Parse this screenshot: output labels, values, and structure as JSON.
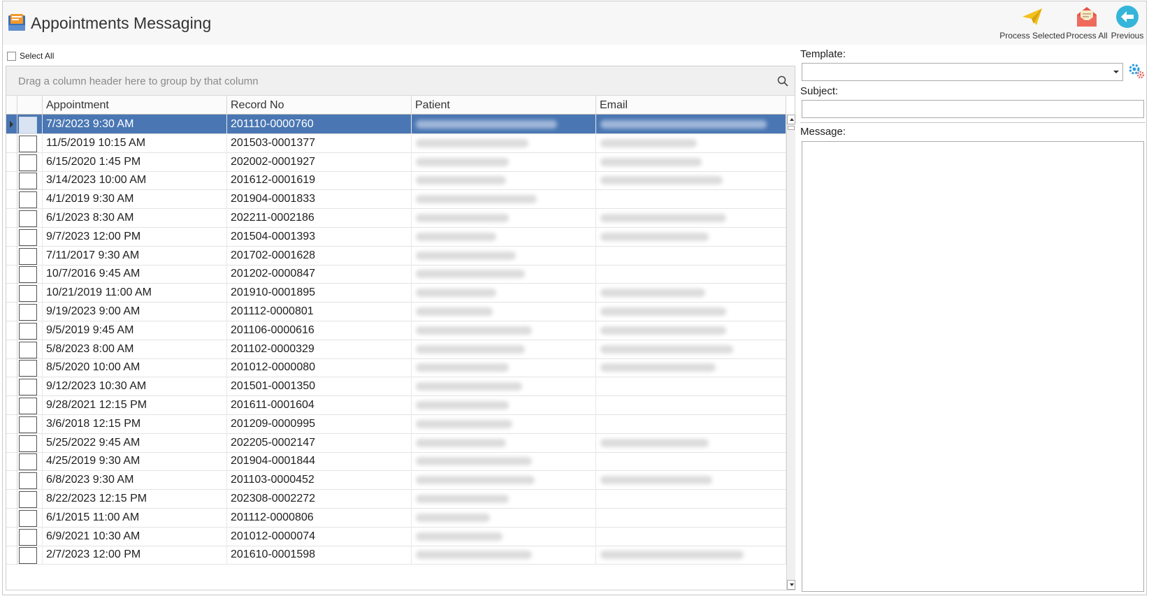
{
  "app": {
    "title": "Appointments Messaging"
  },
  "toolbar": {
    "process_selected": "Process Selected",
    "process_all": "Process All",
    "previous": "Previous"
  },
  "select_all": {
    "label": "Select All",
    "checked": false
  },
  "grid": {
    "group_hint": "Drag a column header here to group by that column",
    "columns": [
      "Appointment",
      "Record No",
      "Patient",
      "Email"
    ],
    "selected_index": 0,
    "rows": [
      {
        "appointment": "7/3/2023 9:30 AM",
        "record_no": "201110-0000760",
        "patient_w": 0.88,
        "email_w": 0.95
      },
      {
        "appointment": "11/5/2019 10:15 AM",
        "record_no": "201503-0001377",
        "patient_w": 0.7,
        "email_w": 0.55
      },
      {
        "appointment": "6/15/2020 1:45 PM",
        "record_no": "202002-0001927",
        "patient_w": 0.58,
        "email_w": 0.58
      },
      {
        "appointment": "3/14/2023 10:00 AM",
        "record_no": "201612-0001619",
        "patient_w": 0.56,
        "email_w": 0.7
      },
      {
        "appointment": "4/1/2019 9:30 AM",
        "record_no": "201904-0001833",
        "patient_w": 0.75,
        "email_w": 0
      },
      {
        "appointment": "6/1/2023 8:30 AM",
        "record_no": "202211-0002186",
        "patient_w": 0.58,
        "email_w": 0.72
      },
      {
        "appointment": "9/7/2023 12:00 PM",
        "record_no": "201504-0001393",
        "patient_w": 0.5,
        "email_w": 0.62
      },
      {
        "appointment": "7/11/2017 9:30 AM",
        "record_no": "201702-0001628",
        "patient_w": 0.62,
        "email_w": 0
      },
      {
        "appointment": "10/7/2016 9:45 AM",
        "record_no": "201202-0000847",
        "patient_w": 0.68,
        "email_w": 0
      },
      {
        "appointment": "10/21/2019 11:00 AM",
        "record_no": "201910-0001895",
        "patient_w": 0.5,
        "email_w": 0.6
      },
      {
        "appointment": "9/19/2023 9:00 AM",
        "record_no": "201112-0000801",
        "patient_w": 0.48,
        "email_w": 0.72
      },
      {
        "appointment": "9/5/2019 9:45 AM",
        "record_no": "201106-0000616",
        "patient_w": 0.72,
        "email_w": 0.72
      },
      {
        "appointment": "5/8/2023 8:00 AM",
        "record_no": "201102-0000329",
        "patient_w": 0.68,
        "email_w": 0.76
      },
      {
        "appointment": "8/5/2020 10:00 AM",
        "record_no": "201012-0000080",
        "patient_w": 0.58,
        "email_w": 0.66
      },
      {
        "appointment": "9/12/2023 10:30 AM",
        "record_no": "201501-0001350",
        "patient_w": 0.66,
        "email_w": 0
      },
      {
        "appointment": "9/28/2021 12:15 PM",
        "record_no": "201611-0001604",
        "patient_w": 0.58,
        "email_w": 0
      },
      {
        "appointment": "3/6/2018 12:15 PM",
        "record_no": "201209-0000995",
        "patient_w": 0.6,
        "email_w": 0
      },
      {
        "appointment": "5/25/2022 9:45 AM",
        "record_no": "202205-0002147",
        "patient_w": 0.56,
        "email_w": 0.62
      },
      {
        "appointment": "4/25/2019 9:30 AM",
        "record_no": "201904-0001844",
        "patient_w": 0.72,
        "email_w": 0
      },
      {
        "appointment": "6/8/2023 9:30 AM",
        "record_no": "201103-0000452",
        "patient_w": 0.74,
        "email_w": 0.64
      },
      {
        "appointment": "8/22/2023 12:15 PM",
        "record_no": "202308-0002272",
        "patient_w": 0.58,
        "email_w": 0
      },
      {
        "appointment": "6/1/2015 11:00 AM",
        "record_no": "201112-0000806",
        "patient_w": 0.46,
        "email_w": 0
      },
      {
        "appointment": "6/9/2021 10:30 AM",
        "record_no": "201012-0000074",
        "patient_w": 0.54,
        "email_w": 0
      },
      {
        "appointment": "2/7/2023 12:00 PM",
        "record_no": "201610-0001598",
        "patient_w": 0.72,
        "email_w": 0.82
      }
    ]
  },
  "form": {
    "template_label": "Template:",
    "template_value": "",
    "subject_label": "Subject:",
    "subject_value": "",
    "message_label": "Message:",
    "message_value": ""
  },
  "colors": {
    "selected_row": "#4a77b3",
    "send_icon": "#f3c21b",
    "mail_icon": "#e4574b",
    "back_icon": "#35b5d9"
  }
}
